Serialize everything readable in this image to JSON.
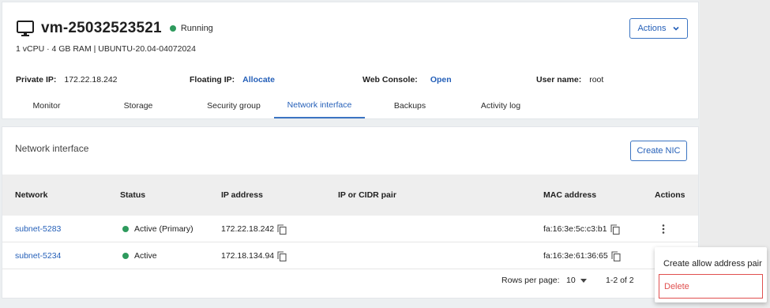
{
  "vm": {
    "name": "vm-25032523521",
    "status": "Running",
    "specs": "1 vCPU · 4 GB RAM  |  UBUNTU-20.04-04072024",
    "actions_label": "Actions"
  },
  "info": {
    "private_ip_label": "Private IP:",
    "private_ip_value": "172.22.18.242",
    "floating_ip_label": "Floating IP:",
    "floating_ip_link": "Allocate",
    "web_console_label": "Web Console:",
    "web_console_link": "Open",
    "username_label": "User name:",
    "username_value": "root"
  },
  "tabs": [
    {
      "label": "Monitor"
    },
    {
      "label": "Storage"
    },
    {
      "label": "Security group"
    },
    {
      "label": "Network interface",
      "active": true
    },
    {
      "label": "Backups"
    },
    {
      "label": "Activity log"
    }
  ],
  "network": {
    "title": "Network interface",
    "create_label": "Create NIC",
    "columns": [
      "Network",
      "Status",
      "IP address",
      "IP or CIDR pair",
      "MAC address",
      "Actions"
    ],
    "rows": [
      {
        "network": "subnet-5283",
        "status": "Active (Primary)",
        "ip": "172.22.18.242",
        "cidr": "",
        "mac": "fa:16:3e:5c:c3:b1"
      },
      {
        "network": "subnet-5234",
        "status": "Active",
        "ip": "172.18.134.94",
        "cidr": "",
        "mac": "fa:16:3e:61:36:65"
      }
    ],
    "rows_per_page_label": "Rows per page:",
    "rows_per_page_value": "10",
    "page_range": "1-2 of 2"
  },
  "context_menu": {
    "items": [
      "Create allow address pair",
      "Delete"
    ]
  },
  "colors": {
    "accent": "#245fb8",
    "status_green": "#2e9a5d",
    "danger": "#e0504f"
  },
  "icons": [
    "monitor-icon",
    "chevron-down-icon",
    "copy-icon",
    "kebab-menu-icon",
    "caret-down-icon"
  ]
}
